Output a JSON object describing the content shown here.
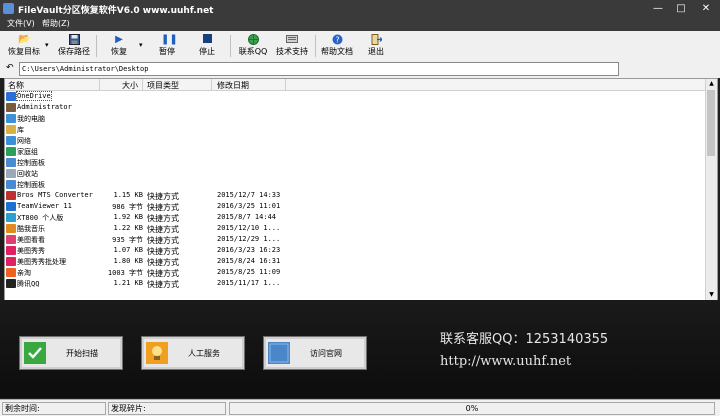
{
  "window": {
    "title": "FileVault分区恢复软件V6.0 www.uuhf.net",
    "min": "—",
    "max": "□",
    "close": "✕"
  },
  "menu": {
    "file": "文件(V)",
    "help": "帮助(Z)"
  },
  "toolbar": {
    "recover_target": "恢复目标",
    "save_path": "保存路径",
    "recover": "恢复",
    "pause": "暂停",
    "stop": "停止",
    "contact_qq": "联系QQ",
    "tech_support": "技术支持",
    "help_doc": "帮助文档",
    "exit": "退出"
  },
  "address": {
    "path": "C:\\Users\\Administrator\\Desktop"
  },
  "list": {
    "headers": {
      "name": "名称",
      "size": "大小",
      "type": "项目类型",
      "date": "修改日期"
    },
    "rows": [
      {
        "name": "OneDrive",
        "size": "",
        "type": "",
        "date": "",
        "icon_color": "#2b6fd6"
      },
      {
        "name": "Administrator",
        "size": "",
        "type": "",
        "date": "",
        "icon_color": "#7a5a3a"
      },
      {
        "name": "我的电脑",
        "size": "",
        "type": "",
        "date": "",
        "icon_color": "#3d8fd8"
      },
      {
        "name": "库",
        "size": "",
        "type": "",
        "date": "",
        "icon_color": "#d8b048"
      },
      {
        "name": "网络",
        "size": "",
        "type": "",
        "date": "",
        "icon_color": "#3d8fd8"
      },
      {
        "name": "家庭组",
        "size": "",
        "type": "",
        "date": "",
        "icon_color": "#2c9f5a"
      },
      {
        "name": "控制面板",
        "size": "",
        "type": "",
        "date": "",
        "icon_color": "#4a8ad0"
      },
      {
        "name": "回收站",
        "size": "",
        "type": "",
        "date": "",
        "icon_color": "#9aa8b8"
      },
      {
        "name": "控制面板",
        "size": "",
        "type": "",
        "date": "",
        "icon_color": "#4a8ad0"
      },
      {
        "name": "Bros MTS Converter",
        "size": "1.15 KB",
        "type": "快捷方式",
        "date": "2015/12/7 14:33",
        "icon_color": "#c03030"
      },
      {
        "name": "TeamViewer 11",
        "size": "986 字节",
        "type": "快捷方式",
        "date": "2016/3/25 11:01",
        "icon_color": "#1f6fd0"
      },
      {
        "name": "XT800 个人版",
        "size": "1.92 KB",
        "type": "快捷方式",
        "date": "2015/8/7 14:44",
        "icon_color": "#2a9fd0"
      },
      {
        "name": "酷我音乐",
        "size": "1.22 KB",
        "type": "快捷方式",
        "date": "2015/12/10 1...",
        "icon_color": "#e08a20"
      },
      {
        "name": "美图看看",
        "size": "935 字节",
        "type": "快捷方式",
        "date": "2015/12/29 1...",
        "icon_color": "#e04070"
      },
      {
        "name": "美图秀秀",
        "size": "1.07 KB",
        "type": "快捷方式",
        "date": "2016/3/23 16:23",
        "icon_color": "#e02060"
      },
      {
        "name": "美图秀秀批处理",
        "size": "1.80 KB",
        "type": "快捷方式",
        "date": "2015/8/24 16:31",
        "icon_color": "#e02060"
      },
      {
        "name": "亲淘",
        "size": "1003 字节",
        "type": "快捷方式",
        "date": "2015/8/25 11:09",
        "icon_color": "#f06020"
      },
      {
        "name": "腾讯QQ",
        "size": "1.21 KB",
        "type": "快捷方式",
        "date": "2015/11/17 1...",
        "icon_color": "#222222"
      }
    ]
  },
  "bottom": {
    "start_scan": "开始扫描",
    "manual_service": "人工服务",
    "visit_site": "访问官网",
    "contact_line": "联系客服QQ：1253140355",
    "url_line": "http://www.uuhf.net"
  },
  "status": {
    "remaining": "剩余时间:",
    "found": "发现碎片:",
    "progress": "0%"
  },
  "colors": {
    "dark_chrome": "#3a3a3a",
    "panel_bg": "#111111",
    "scan_green": "#3aa840",
    "service_orange": "#e89a20",
    "site_blue": "#4a86c8"
  }
}
